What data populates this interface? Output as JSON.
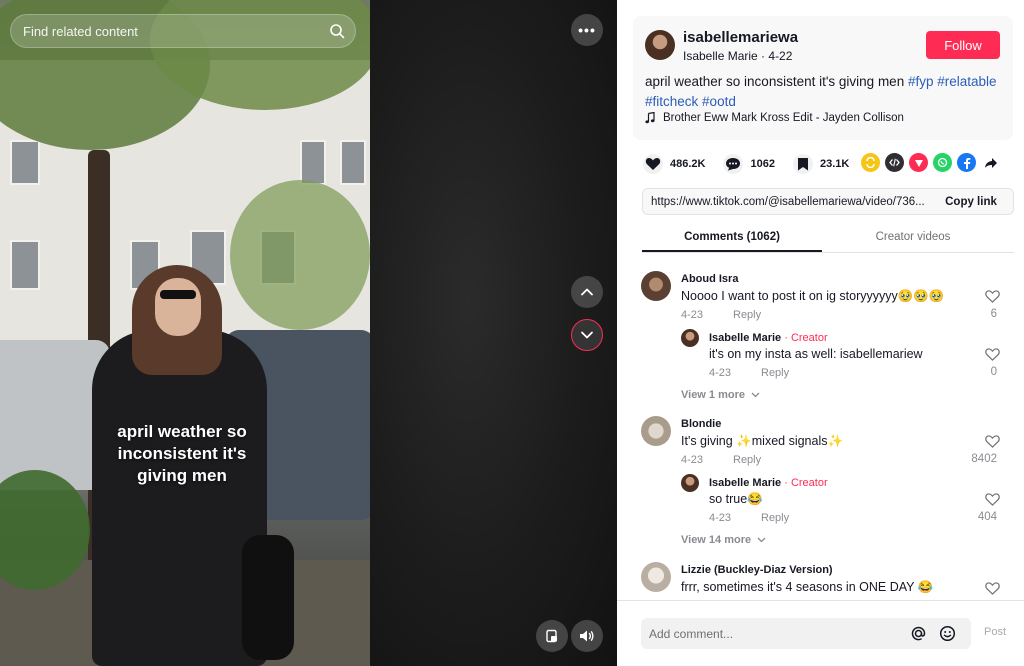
{
  "video": {
    "search_placeholder": "Find related content",
    "caption_overlay": "april weather so inconsistent it's giving men",
    "more_label": "•••"
  },
  "author": {
    "username": "isabellemariewa",
    "display_name": "Isabelle Marie",
    "date": "4-22",
    "follow_label": "Follow",
    "description_text": "april weather so inconsistent it's giving men",
    "hashtags": [
      "#fyp",
      "#relatable",
      "#fitcheck",
      "#ootd"
    ],
    "music": "Brother Eww Mark Kross Edit - Jayden Collison"
  },
  "stats": {
    "likes": "486.2K",
    "comments": "1062",
    "saves": "23.1K"
  },
  "share_icons": [
    "repost-icon",
    "embed-icon",
    "send-icon",
    "whatsapp-icon",
    "facebook-icon",
    "share-arrow-icon"
  ],
  "link": {
    "url": "https://www.tiktok.com/@isabellemariewa/video/736...",
    "copy_label": "Copy link"
  },
  "tabs": {
    "comments": "Comments (1062)",
    "creator_videos": "Creator videos"
  },
  "comments": [
    {
      "name": "Aboud Isra",
      "text": "Noooo I want to post it on ig storyyyyyy🥹🥹🥹",
      "date": "4-23",
      "reply": "Reply",
      "likes": "6",
      "reply_item": {
        "name": "Isabelle Marie",
        "creator": "Creator",
        "text": "it's on my insta as well: isabellemariew",
        "date": "4-23",
        "reply": "Reply",
        "likes": "0"
      },
      "view_more": "View 1 more"
    },
    {
      "name": "Blondie",
      "text": "It's giving ✨mixed signals✨",
      "date": "4-23",
      "reply": "Reply",
      "likes": "8402",
      "reply_item": {
        "name": "Isabelle Marie",
        "creator": "Creator",
        "text": "so true😂",
        "date": "4-23",
        "reply": "Reply",
        "likes": "404"
      },
      "view_more": "View 14 more"
    },
    {
      "name": "Lizzie (Buckley-Diaz Version)",
      "text": "frrr, sometimes it's 4 seasons in ONE DAY 😂"
    }
  ],
  "comment_bar": {
    "placeholder": "Add comment...",
    "post_label": "Post"
  },
  "colors": {
    "accent": "#fe2c55",
    "hashtag": "#2b5db9",
    "muted": "#8a8b91"
  }
}
